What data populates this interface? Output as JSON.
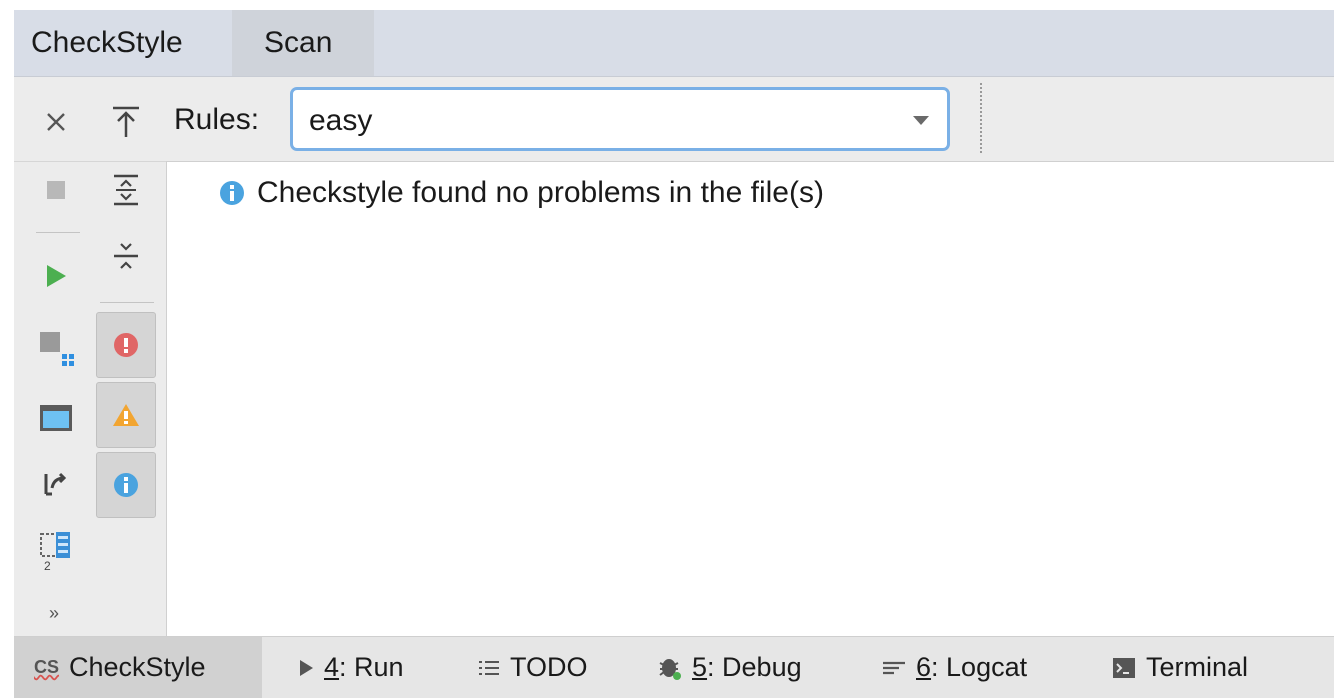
{
  "tabs": {
    "checkstyle": "CheckStyle",
    "scan": "Scan"
  },
  "toolbar": {
    "rules_label": "Rules:",
    "rules_value": "easy"
  },
  "content": {
    "message": "Checkstyle found no problems in the file(s)"
  },
  "sidebar": {
    "icons": [
      "close-icon",
      "stop-icon",
      "run-icon",
      "module-scan-icon",
      "window-icon",
      "rerun-icon",
      "project-scan-icon",
      "more-icon"
    ],
    "col2_icons": [
      "scroll-up-icon",
      "expand-all-icon",
      "collapse-all-icon"
    ],
    "filters": [
      "error-filter-icon",
      "warning-filter-icon",
      "info-filter-icon"
    ],
    "more_label": "»"
  },
  "statusbar": {
    "checkstyle_badge": "CS",
    "checkstyle": "CheckStyle",
    "run_num": "4",
    "run": ": Run",
    "todo": "TODO",
    "debug_num": "5",
    "debug": ": Debug",
    "logcat_num": "6",
    "logcat": ": Logcat",
    "terminal": "Terminal"
  },
  "colors": {
    "accent_border": "#7ab0e6",
    "run_green": "#4caf50",
    "error_red": "#e06666",
    "warning_orange": "#f2a531",
    "info_blue": "#4aa3df"
  }
}
